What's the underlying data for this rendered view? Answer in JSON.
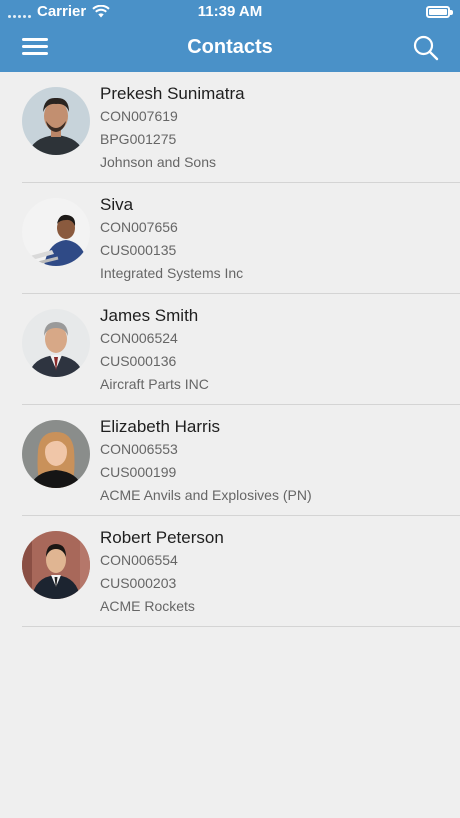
{
  "status_bar": {
    "carrier": "Carrier",
    "time": "11:39 AM"
  },
  "nav": {
    "title": "Contacts",
    "menu_icon": "hamburger-menu-icon",
    "search_icon": "search-icon"
  },
  "contacts": [
    {
      "name": "Prekesh Sunimatra",
      "contact_id": "CON007619",
      "account_id": "BPG001275",
      "company": "Johnson and Sons"
    },
    {
      "name": "Siva",
      "contact_id": "CON007656",
      "account_id": "CUS000135",
      "company": "Integrated Systems Inc"
    },
    {
      "name": "James Smith",
      "contact_id": "CON006524",
      "account_id": "CUS000136",
      "company": "Aircraft Parts INC"
    },
    {
      "name": "Elizabeth Harris",
      "contact_id": "CON006553",
      "account_id": "CUS000199",
      "company": "ACME Anvils and Explosives (PN)"
    },
    {
      "name": "Robert Peterson",
      "contact_id": "CON006554",
      "account_id": "CUS000203",
      "company": "ACME Rockets"
    }
  ],
  "colors": {
    "nav_bar": "#4a91c8",
    "background": "#efefef",
    "divider": "#d4d4d4"
  }
}
